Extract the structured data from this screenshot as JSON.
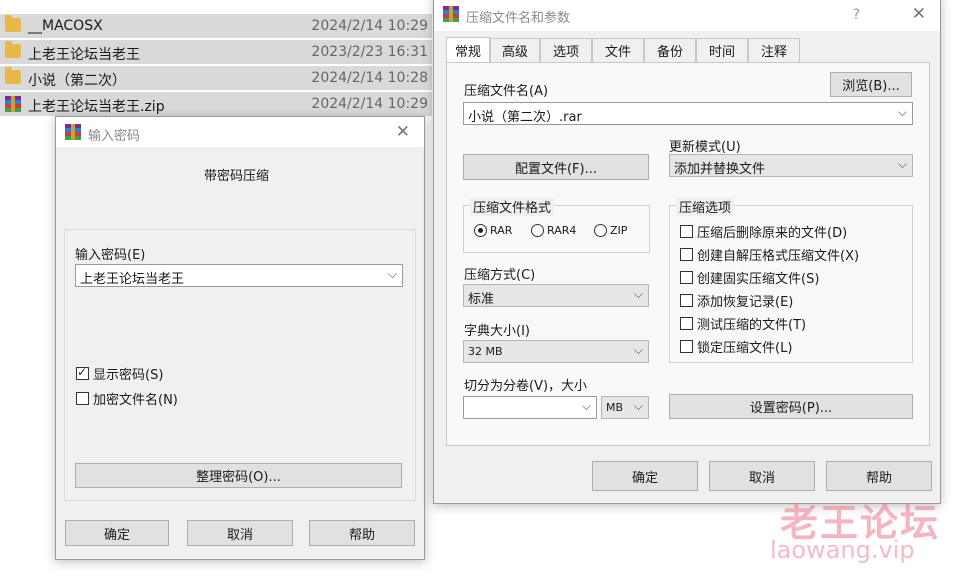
{
  "files": [
    {
      "name": "__MACOSX",
      "date": "2024/2/14 10:29",
      "icon": "folder-icon"
    },
    {
      "name": "上老王论坛当老王",
      "date": "2023/2/23 16:31",
      "icon": "folder-icon"
    },
    {
      "name": "小说（第二次）",
      "date": "2024/2/14 10:28",
      "icon": "folder-icon"
    },
    {
      "name": "上老王论坛当老王.zip",
      "date": "2024/2/14 10:29",
      "icon": "winrar-icon"
    }
  ],
  "password_dialog": {
    "title": "输入密码",
    "heading": "带密码压缩",
    "password_label": "输入密码(E)",
    "password_value": "上老王论坛当老王",
    "show_password": "显示密码(S)",
    "encrypt_names": "加密文件名(N)",
    "organize_button": "整理密码(O)...",
    "ok": "确定",
    "cancel": "取消",
    "help": "帮助"
  },
  "archive_dialog": {
    "title": "压缩文件名和参数",
    "help_mark": "?",
    "tabs": [
      "常规",
      "高级",
      "选项",
      "文件",
      "备份",
      "时间",
      "注释"
    ],
    "archive_name_label": "压缩文件名(A)",
    "browse_button": "浏览(B)...",
    "archive_name_value": "小说（第二次）.rar",
    "profile_button": "配置文件(F)...",
    "update_mode_label": "更新模式(U)",
    "update_mode_value": "添加并替换文件",
    "format_label": "压缩文件格式",
    "formats": [
      "RAR",
      "RAR4",
      "ZIP"
    ],
    "method_label": "压缩方式(C)",
    "method_value": "标准",
    "dict_label": "字典大小(I)",
    "dict_value": "32 MB",
    "split_label": "切分为分卷(V)，大小",
    "split_unit": "MB",
    "options_label": "压缩选项",
    "options": [
      "压缩后删除原来的文件(D)",
      "创建自解压格式压缩文件(X)",
      "创建固实压缩文件(S)",
      "添加恢复记录(E)",
      "测试压缩的文件(T)",
      "锁定压缩文件(L)"
    ],
    "set_password_button": "设置密码(P)...",
    "ok": "确定",
    "cancel": "取消",
    "help": "帮助"
  },
  "watermark": {
    "text": "老王论坛",
    "url": "laowang.vip"
  }
}
